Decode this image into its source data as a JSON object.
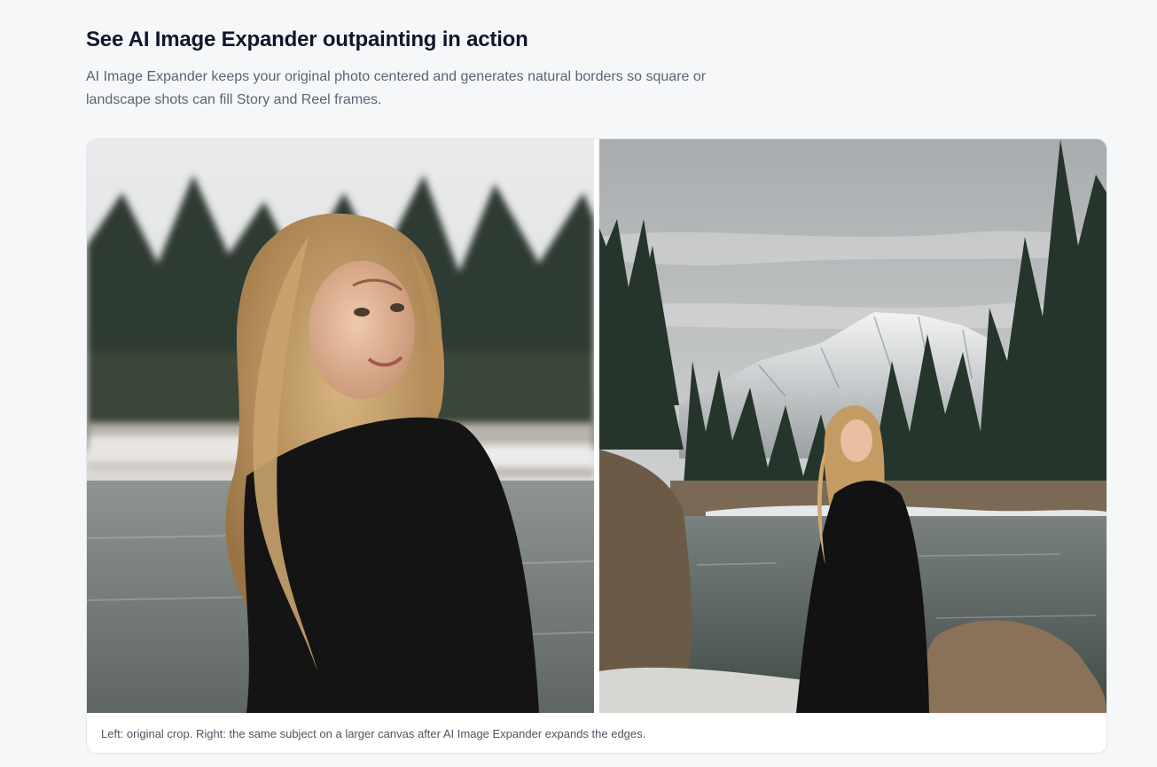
{
  "section": {
    "title": "See AI Image Expander outpainting in action",
    "description": "AI Image Expander keeps your original photo centered and generates natural borders so square or landscape shots can fill Story and Reel frames."
  },
  "comparison": {
    "left_image": {
      "description_icon": "original-crop-photo"
    },
    "right_image": {
      "description_icon": "expanded-canvas-photo"
    },
    "caption": "Left: original crop. Right: the same subject on a larger canvas after AI Image Expander expands the edges."
  },
  "colors": {
    "page_background": "#f6f7f9",
    "title": "#0f172a",
    "body_text": "#5b6472",
    "card_border": "#e3e6ea"
  }
}
